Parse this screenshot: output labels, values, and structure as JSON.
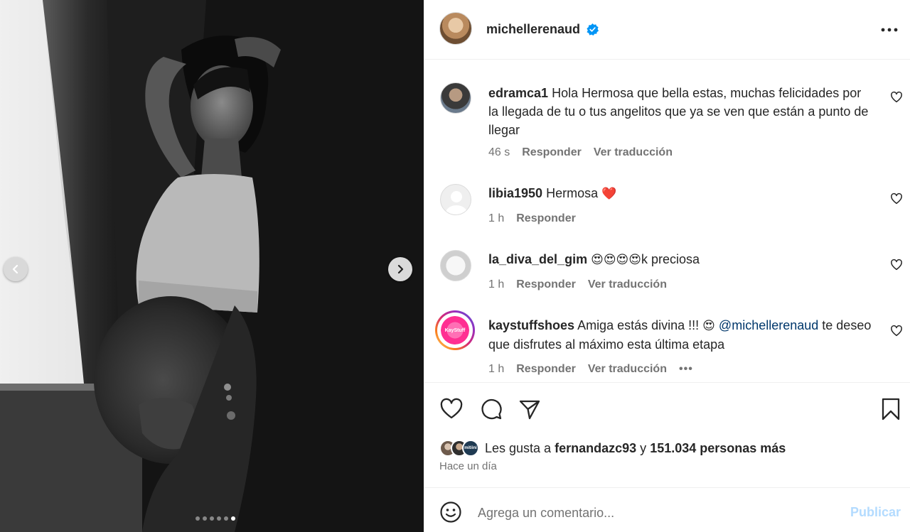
{
  "post": {
    "username": "michellerenaud",
    "verified": true,
    "carousel": {
      "total": 6,
      "active_index": 5
    }
  },
  "comments": [
    {
      "username": "edramca1",
      "text": "Hola Hermosa que bella estas, muchas felicidades por la llegada de tu o tus angelitos que ya se ven que están a punto de llegar",
      "time": "46 s",
      "reply_label": "Responder",
      "translate_label": "Ver traducción"
    },
    {
      "username": "libia1950",
      "text": "Hermosa",
      "emoji": "❤️",
      "time": "1 h",
      "reply_label": "Responder"
    },
    {
      "username": "la_diva_del_gim",
      "emojis": "😍😍😍😍",
      "text": "k preciosa",
      "time": "1 h",
      "reply_label": "Responder",
      "translate_label": "Ver traducción"
    },
    {
      "username": "kaystuffshoes",
      "text_before": "Amiga estás divina !!!",
      "emoji": "😍",
      "mention": "@michellerenaud",
      "text_after": "te deseo que disfrutes al máximo esta última etapa",
      "time": "1 h",
      "reply_label": "Responder",
      "translate_label": "Ver traducción",
      "more": "•••",
      "avatar_text": "KayStuff"
    }
  ],
  "likes": {
    "prefix": "Les gusta a",
    "user": "fernandazc93",
    "connector": "y",
    "others": "151.034 personas más",
    "mini_avatar_text": "mitiini"
  },
  "time_ago": "Hace un día",
  "add_comment": {
    "placeholder": "Agrega un comentario...",
    "publish_label": "Publicar"
  },
  "colors": {
    "text": "#262626",
    "secondary": "#737373",
    "link": "#00376b",
    "verified": "#0095f6",
    "publish_disabled": "#b3dbff"
  },
  "icons": {
    "verified": "verified-badge-icon",
    "more": "more-options-icon",
    "like": "heart-icon",
    "comment": "comment-icon",
    "share": "share-icon",
    "save": "bookmark-icon",
    "emoji": "emoji-icon",
    "prev": "chevron-left-icon",
    "next": "chevron-right-icon"
  }
}
